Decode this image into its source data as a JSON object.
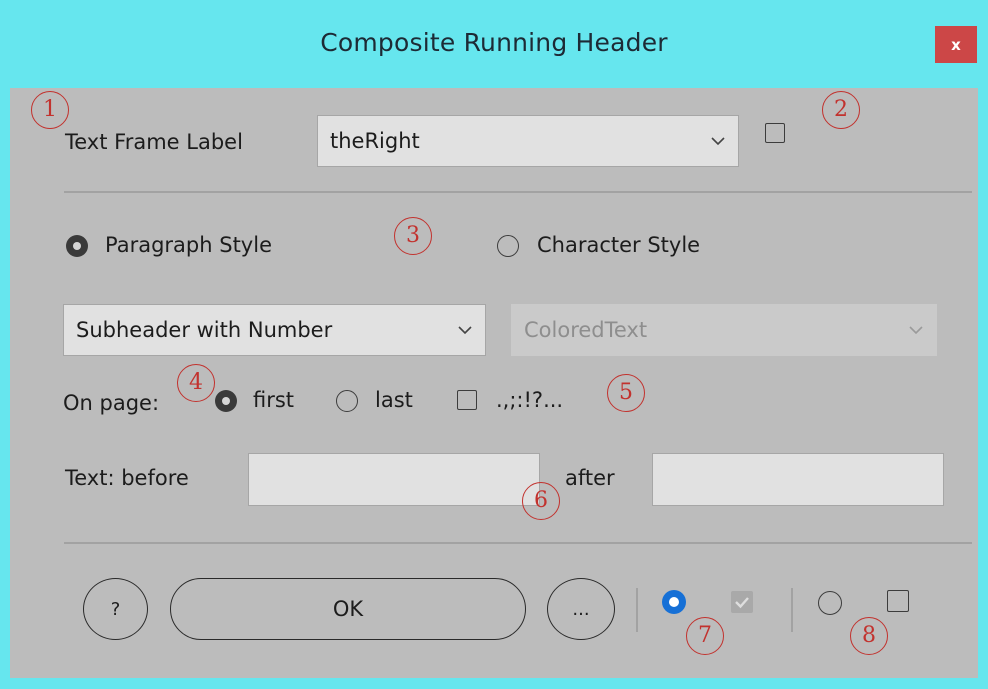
{
  "window": {
    "title": "Composite Running Header",
    "close_label": "x"
  },
  "frame_label": {
    "label": "Text Frame Label",
    "value": "theRight"
  },
  "style_type": {
    "paragraph_label": "Paragraph Style",
    "character_label": "Character Style",
    "selected": "paragraph"
  },
  "paragraph_style": {
    "value": "Subheader with Number"
  },
  "character_style": {
    "value": "ColoredText",
    "enabled": false
  },
  "on_page": {
    "label": "On page:",
    "first_label": "first",
    "last_label": "last",
    "punct_label": ".,;:!?...",
    "selected": "first"
  },
  "text": {
    "before_label": "Text: before",
    "after_label": "after",
    "before_value": "",
    "after_value": ""
  },
  "buttons": {
    "help": "?",
    "ok": "OK",
    "more": "..."
  },
  "annotations": [
    "1",
    "2",
    "3",
    "4",
    "5",
    "6",
    "7",
    "8"
  ],
  "colors": {
    "titlebar": "#66e6ee",
    "dialog": "#bcbcbc",
    "close": "#cc4747",
    "annotation": "#c2322e",
    "accent_blue": "#1670d6"
  }
}
